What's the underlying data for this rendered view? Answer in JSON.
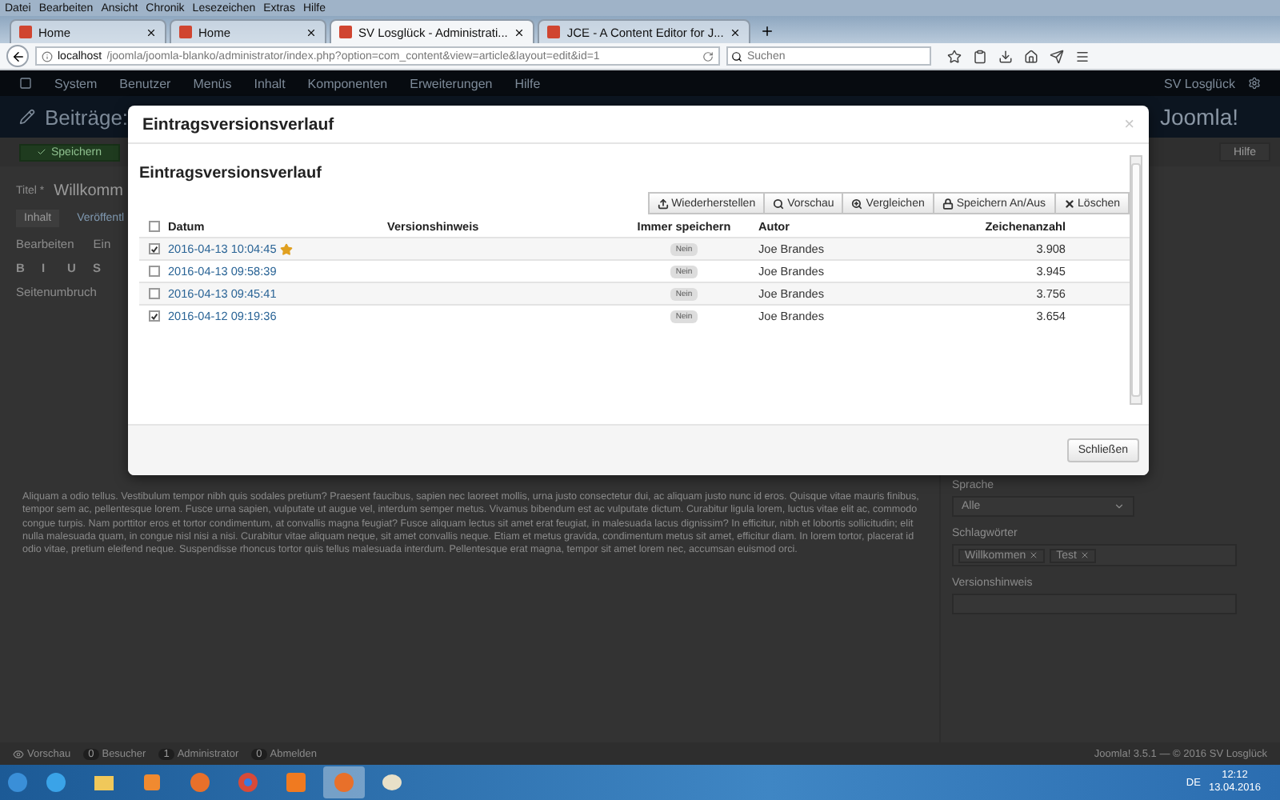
{
  "browser": {
    "menu": [
      "Datei",
      "Bearbeiten",
      "Ansicht",
      "Chronik",
      "Lesezeichen",
      "Extras",
      "Hilfe"
    ],
    "tabs": [
      {
        "title": "Home",
        "selected": false
      },
      {
        "title": "Home",
        "selected": false
      },
      {
        "title": "SV Losglück - Administrati...",
        "selected": true
      },
      {
        "title": "JCE - A Content Editor for J...",
        "selected": false
      }
    ],
    "url_host": "localhost",
    "url_path": "/joomla/joomla-blanko/administrator/index.php?option=com_content&view=article&layout=edit&id=1",
    "search_placeholder": "Suchen"
  },
  "admin": {
    "nav": [
      "System",
      "Benutzer",
      "Menüs",
      "Inhalt",
      "Komponenten",
      "Erweiterungen",
      "Hilfe"
    ],
    "site_name": "SV Losglück",
    "page_title": "Beiträge:",
    "logo": "Joomla!",
    "save_button": "Speichern",
    "help_button": "Hilfe",
    "title_label": "Titel *",
    "title_value": "Willkomm",
    "tabs": [
      {
        "label": "Inhalt",
        "selected": true
      },
      {
        "label": "Veröffentl",
        "selected": false
      }
    ],
    "editor_menu": [
      "Bearbeiten",
      "Ein"
    ],
    "format_buttons": [
      "B",
      "I",
      "U",
      "S"
    ],
    "pagebreak": "Seitenumbruch",
    "paragraph": "Aliquam a odio tellus. Vestibulum tempor nibh quis sodales pretium? Praesent faucibus, sapien nec laoreet mollis, urna justo consectetur dui, ac aliquam justo nunc id eros. Quisque vitae mauris finibus, tempor sem ac, pellentesque lorem. Fusce urna sapien, vulputate ut augue vel, interdum semper metus. Vivamus bibendum est ac vulputate dictum. Curabitur ligula lorem, luctus vitae elit ac, commodo congue turpis. Nam porttitor eros et tortor condimentum, at convallis magna feugiat? Fusce aliquam lectus sit amet erat feugiat, in malesuada lacus dignissim? In efficitur, nibh et lobortis sollicitudin; elit nulla malesuada quam, in congue nisl nisi a nisi. Curabitur vitae aliquam neque, sit amet convallis neque. Etiam et metus gravida, condimentum metus sit amet, efficitur diam. In lorem tortor, placerat id odio vitae, pretium eleifend neque. Suspendisse rhoncus tortor quis tellus malesuada interdum. Pellentesque erat magna, tempor sit amet lorem nec, accumsan euismod orci.",
    "sidebar": {
      "language_label": "Sprache",
      "language_value": "Alle",
      "tags_label": "Schlagwörter",
      "tags": [
        "Willkommen",
        "Test"
      ],
      "note_label": "Versionshinweis"
    },
    "footer": {
      "items": [
        {
          "label": "Vorschau"
        },
        {
          "count": "0",
          "label": "Besucher"
        },
        {
          "count": "1",
          "label": "Administrator"
        },
        {
          "count": "0",
          "label": "Abmelden"
        }
      ],
      "copyright": "Joomla! 3.5.1 — © 2016 SV Losglück"
    }
  },
  "modal": {
    "title": "Eintragsversionsverlauf",
    "close": "×",
    "heading": "Eintragsversionsverlauf",
    "toolbar": [
      {
        "kind": "restore",
        "label": "Wiederherstellen"
      },
      {
        "kind": "preview",
        "label": "Vorschau"
      },
      {
        "kind": "compare",
        "label": "Vergleichen"
      },
      {
        "kind": "keep",
        "label": "Speichern An/Aus"
      },
      {
        "kind": "delete",
        "label": "Löschen"
      }
    ],
    "columns": [
      "Datum",
      "Versionshinweis",
      "Immer speichern",
      "Autor",
      "Zeichenanzahl"
    ],
    "select_all": false,
    "rows": [
      {
        "checked": true,
        "date": "2016-04-13 10:04:45",
        "starred": true,
        "keep": "Nein",
        "author": "Joe Brandes",
        "chars": "3.908"
      },
      {
        "checked": false,
        "date": "2016-04-13 09:58:39",
        "starred": false,
        "keep": "Nein",
        "author": "Joe Brandes",
        "chars": "3.945"
      },
      {
        "checked": false,
        "date": "2016-04-13 09:45:41",
        "starred": false,
        "keep": "Nein",
        "author": "Joe Brandes",
        "chars": "3.756"
      },
      {
        "checked": true,
        "date": "2016-04-12 09:19:36",
        "starred": false,
        "keep": "Nein",
        "author": "Joe Brandes",
        "chars": "3.654"
      }
    ],
    "close_button": "Schließen"
  },
  "taskbar": {
    "language": "DE",
    "time": "12:12",
    "date": "13.04.2016"
  }
}
